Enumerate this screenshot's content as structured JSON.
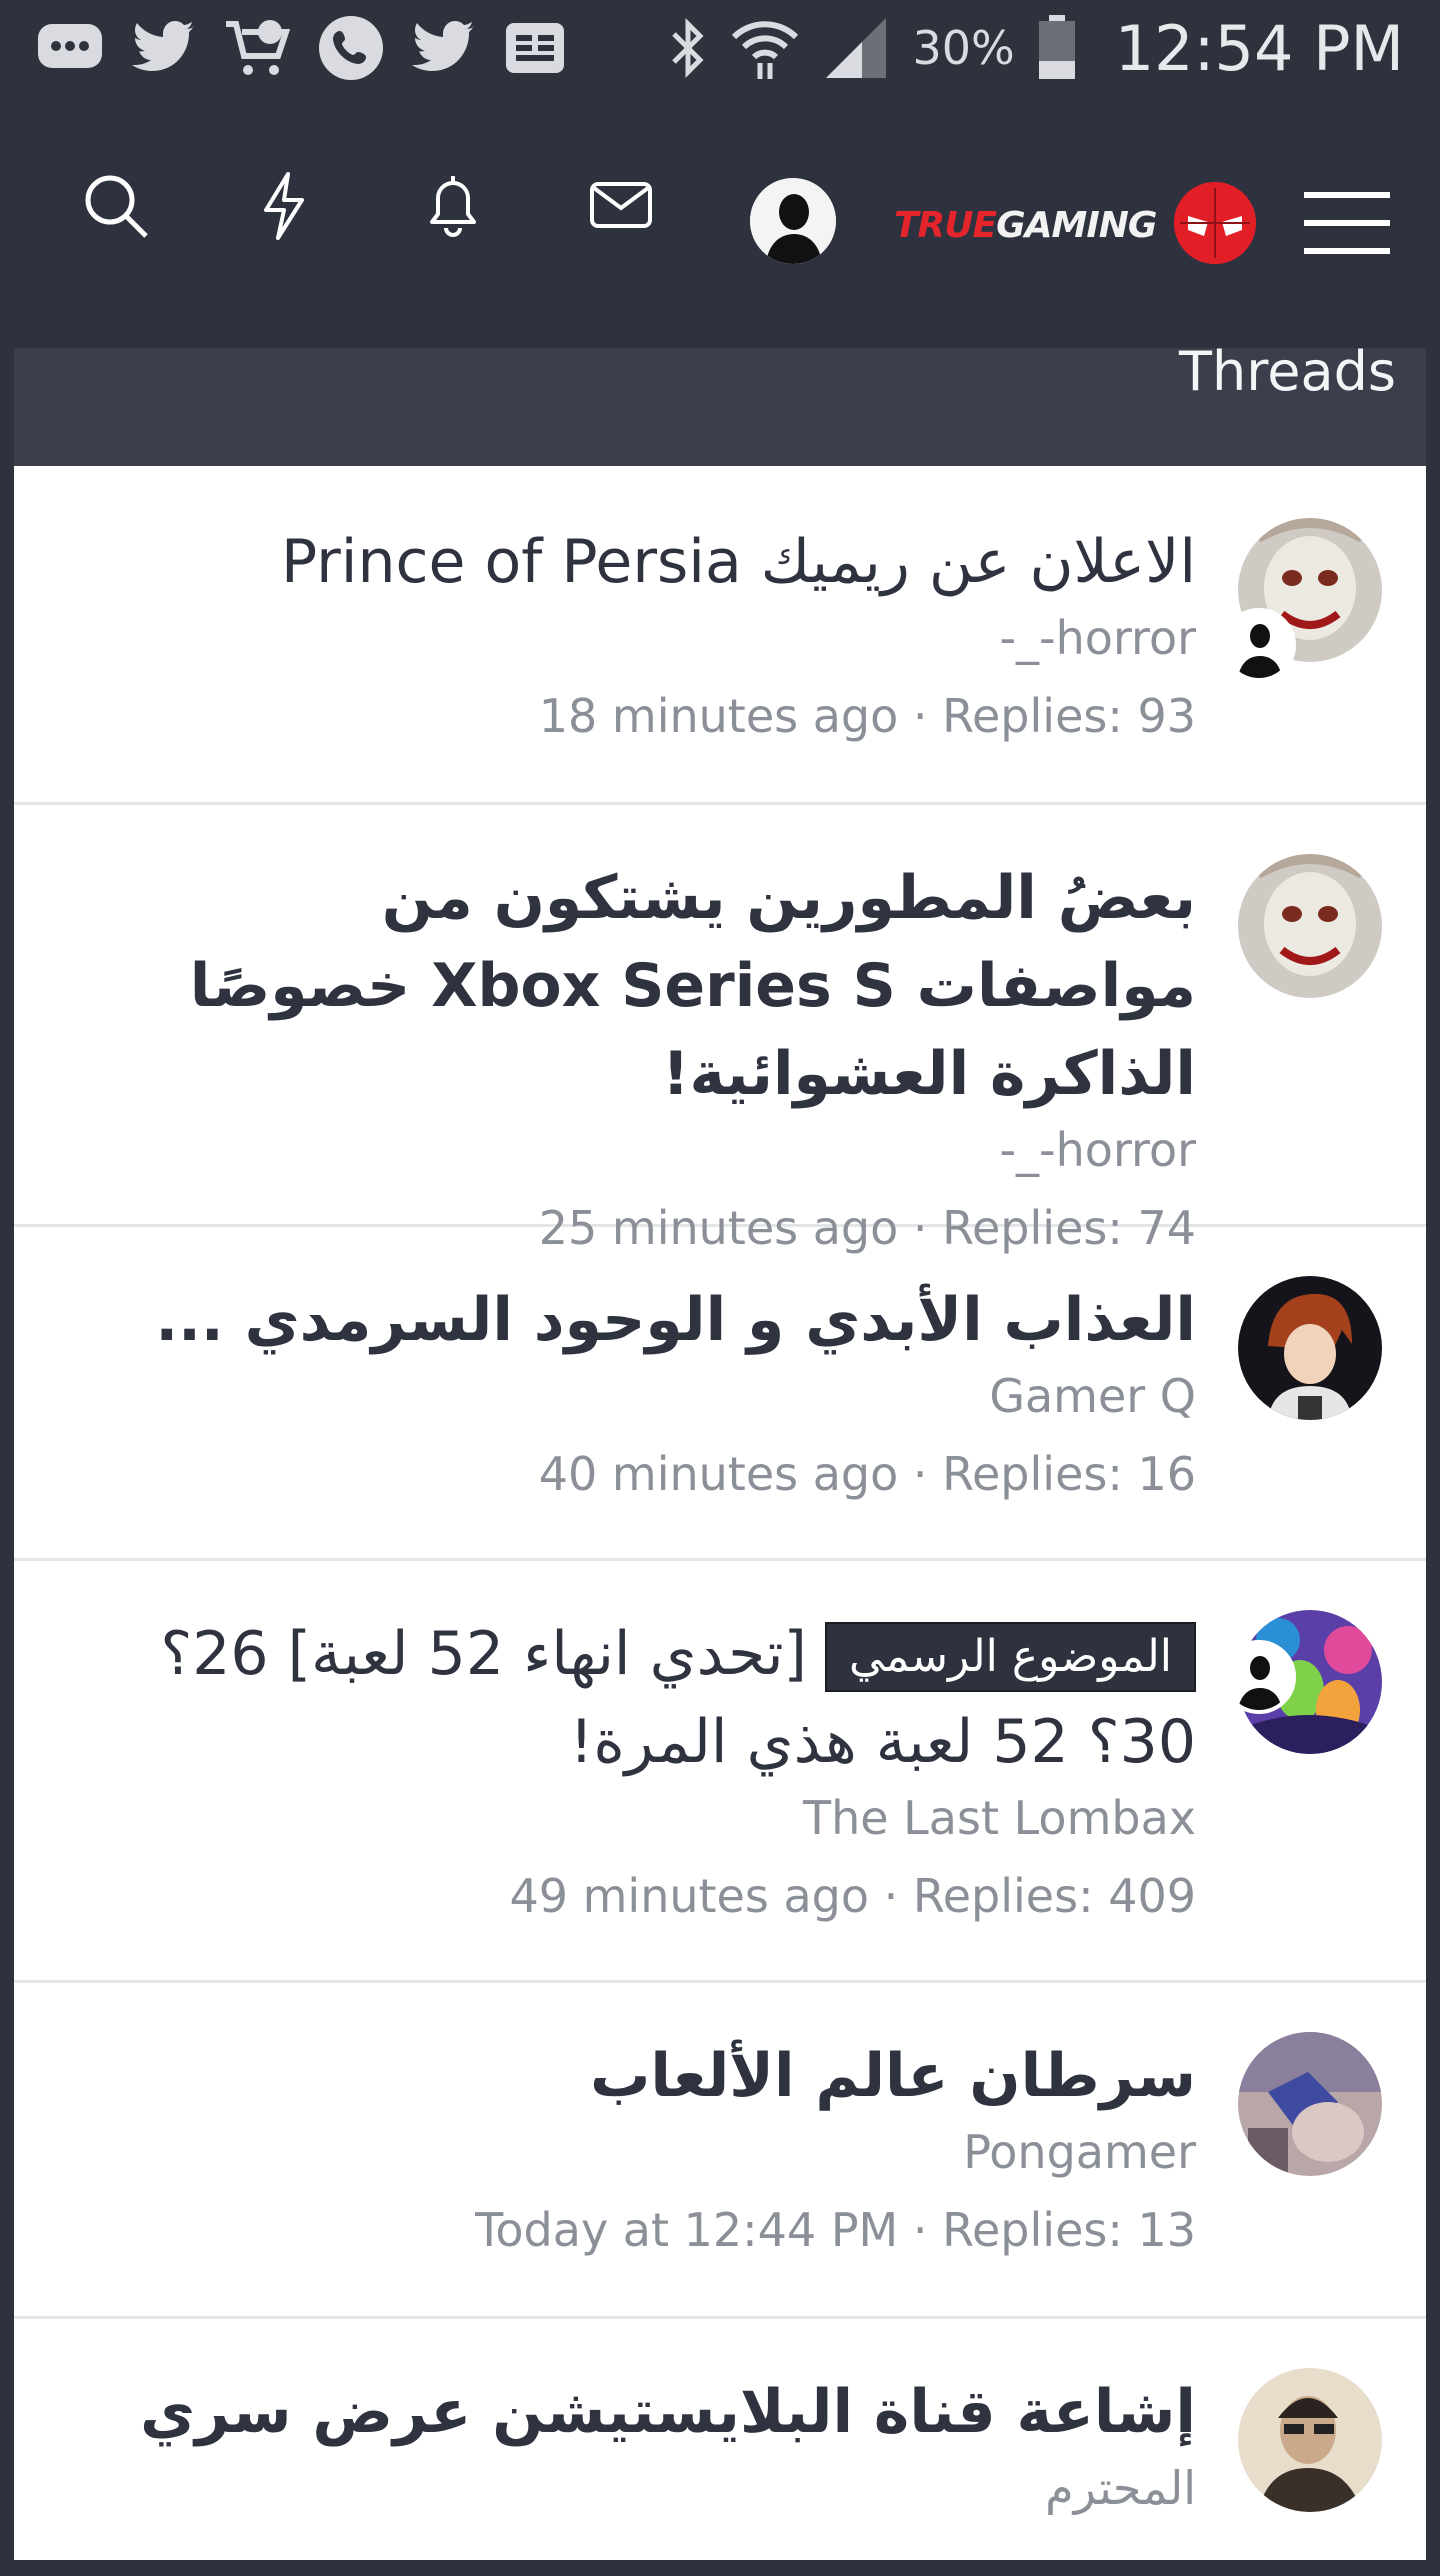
{
  "status_bar": {
    "battery_percent": "30%",
    "time": "12:54 PM",
    "icons_left": [
      "messages-icon",
      "twitter-icon",
      "shopping-cart-icon",
      "phone-icon",
      "twitter-icon",
      "ge-icon"
    ],
    "icons_right": [
      "bluetooth-icon",
      "wifi-icon",
      "signal-icon",
      "battery-icon"
    ]
  },
  "header": {
    "nav_icons": [
      "search-icon",
      "lightning-icon",
      "bell-icon",
      "mail-icon"
    ],
    "brand_true": "TRUE",
    "brand_gaming": "GAMING",
    "menu_icon": "hamburger-menu-icon",
    "colors": {
      "bar": "#2d323e",
      "brand_red": "#e4252c"
    }
  },
  "section": {
    "title": "Threads"
  },
  "threads": [
    {
      "title": "الاعلان عن ريميك Prince of Persia",
      "author": "horror-_-",
      "meta": "18 minutes ago · Replies: 93",
      "has_mini_avatar": true
    },
    {
      "title": "بعضُ المطورين يشتكون من مواصفات Xbox Series S خصوصًا الذاكرة العشوائية!",
      "author": "horror-_-",
      "meta": "25 minutes ago · Replies: 74",
      "has_mini_avatar": false
    },
    {
      "title": "العذاب الأبدي و الوحود السرمدي ...",
      "author": "Gamer Q",
      "meta": "40 minutes ago · Replies: 16",
      "has_mini_avatar": false
    },
    {
      "badge": "الموضوع الرسمي",
      "title": "[تحدي انهاء 52 لعبة] 26؟ 30؟ 52 لعبة هذي المرة!",
      "author": "The Last Lombax",
      "meta": "49 minutes ago · Replies: 409",
      "has_mini_avatar": true
    },
    {
      "title": "سرطان عالم الألعاب",
      "author": "Pongamer",
      "meta": "Today at 12:44 PM · Replies: 13",
      "has_mini_avatar": false
    },
    {
      "title": "إشاعة قناة البلايستيشن عرض سري",
      "author": "المحترم",
      "meta": "",
      "has_mini_avatar": false
    }
  ]
}
